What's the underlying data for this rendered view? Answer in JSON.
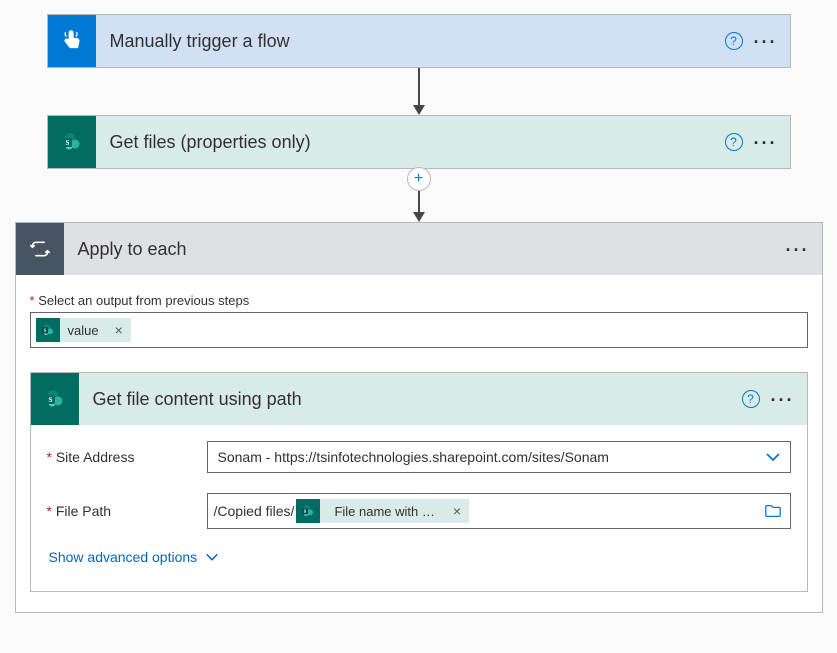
{
  "steps": {
    "trigger": {
      "title": "Manually trigger a flow"
    },
    "getFiles": {
      "title": "Get files (properties only)"
    },
    "applyEach": {
      "title": "Apply to each",
      "outputLabel": "Select an output from previous steps",
      "token": "value"
    },
    "getFileContent": {
      "title": "Get file content using path",
      "siteLabel": "Site Address",
      "siteValue": "Sonam - https://tsinfotechnologies.sharepoint.com/sites/Sonam",
      "pathLabel": "File Path",
      "pathPrefix": "/Copied files/",
      "pathToken": "File name with …",
      "advancedLabel": "Show advanced options"
    }
  },
  "glyphs": {
    "asterisk": "*",
    "close": "×",
    "plus": "+",
    "question": "?",
    "dots": "..."
  }
}
